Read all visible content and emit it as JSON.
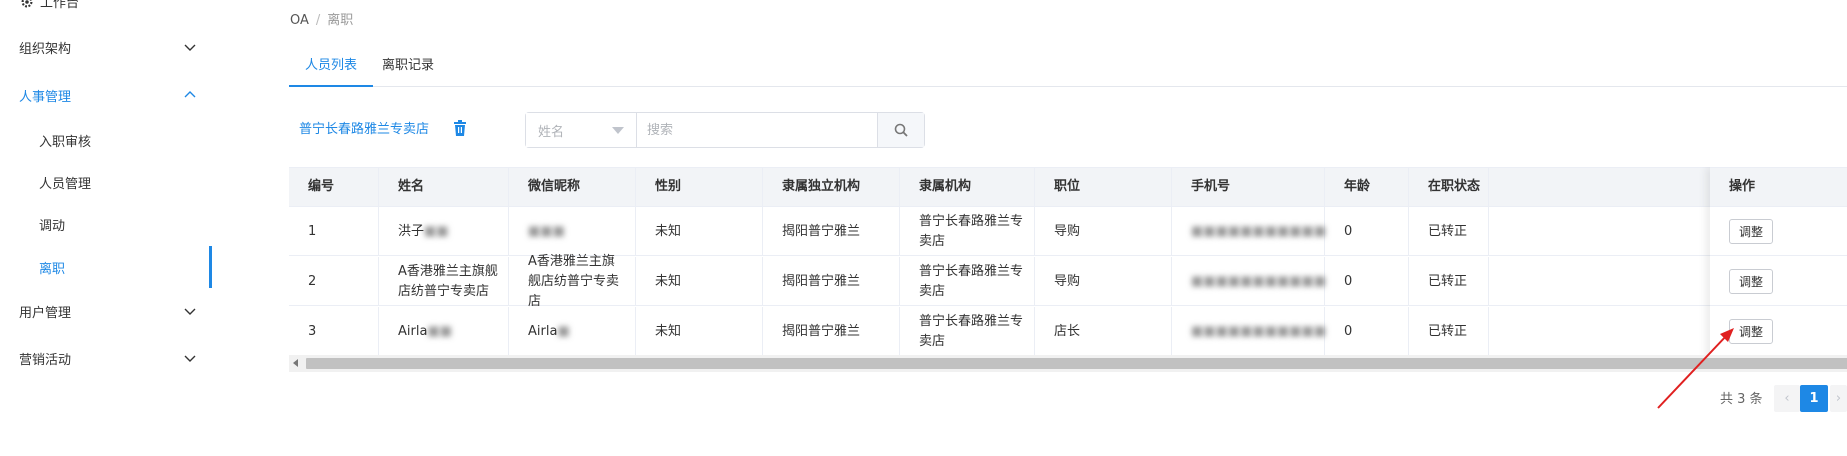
{
  "sidebar": {
    "top_label": "工作台",
    "menus": [
      {
        "label": "组织架构",
        "state": "collapsed"
      },
      {
        "label": "人事管理",
        "state": "expanded"
      },
      {
        "label": "用户管理",
        "state": "collapsed"
      },
      {
        "label": "营销活动",
        "state": "collapsed"
      }
    ],
    "submenus": [
      {
        "label": "入职审核"
      },
      {
        "label": "人员管理"
      },
      {
        "label": "调动"
      },
      {
        "label": "离职",
        "active": true
      }
    ]
  },
  "breadcrumb": {
    "root": "OA",
    "separator": "/",
    "current": "离职"
  },
  "tabs": [
    {
      "label": "人员列表",
      "active": true
    },
    {
      "label": "离职记录",
      "active": false
    }
  ],
  "filter": {
    "store_name": "普宁长春路雅兰专卖店",
    "field_select": "姓名",
    "search_placeholder": "搜索"
  },
  "table": {
    "columns": [
      "编号",
      "姓名",
      "微信昵称",
      "性别",
      "隶属独立机构",
      "隶属机构",
      "职位",
      "手机号",
      "年龄",
      "在职状态",
      "操作"
    ],
    "rows": [
      {
        "id": "1",
        "name": "洪子",
        "name_masked": "■■",
        "wechat": "",
        "wechat_masked": "■■■",
        "gender": "未知",
        "org_independent": "揭阳普宁雅兰",
        "org": "普宁长春路雅兰专卖店",
        "position": "导购",
        "phone_masked": "■■■■■■■■■■■",
        "age": "0",
        "status": "已转正",
        "action": "调整"
      },
      {
        "id": "2",
        "name": "A香港雅兰主旗舰店纺普宁专卖店",
        "name_masked": "",
        "wechat": "A香港雅兰主旗舰店纺普宁专卖店",
        "wechat_masked": "",
        "gender": "未知",
        "org_independent": "揭阳普宁雅兰",
        "org": "普宁长春路雅兰专卖店",
        "position": "导购",
        "phone_masked": "■■■■■■■■■■■",
        "age": "0",
        "status": "已转正",
        "action": "调整"
      },
      {
        "id": "3",
        "name": "Airla",
        "name_masked": "■■",
        "wechat": "Airla",
        "wechat_masked": "■",
        "gender": "未知",
        "org_independent": "揭阳普宁雅兰",
        "org": "普宁长春路雅兰专卖店",
        "position": "店长",
        "phone_masked": "■■■■■■■■■■■",
        "age": "0",
        "status": "已转正",
        "action": "调整"
      }
    ]
  },
  "pagination": {
    "total_text": "共 3 条",
    "current_page": "1",
    "prev": "‹",
    "next": "›"
  },
  "annotation": {
    "color": "#e02020"
  }
}
